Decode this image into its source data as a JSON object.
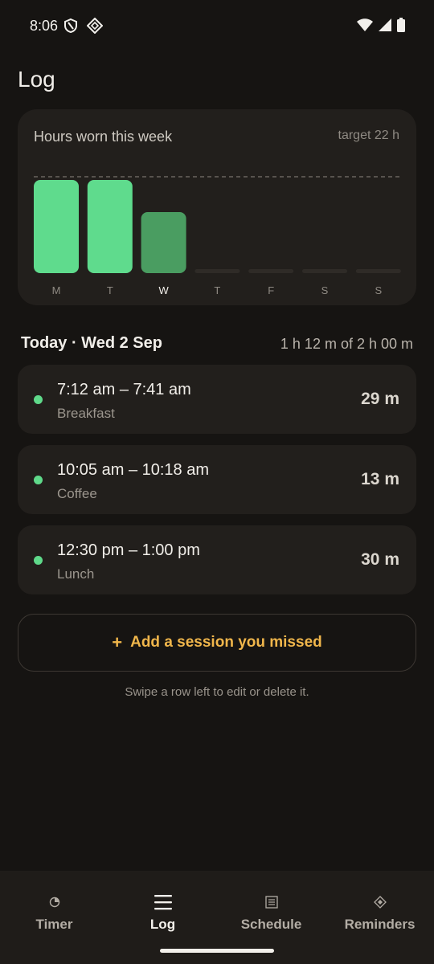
{
  "status_bar": {
    "time": "8:06"
  },
  "page": {
    "title": "Log"
  },
  "chart": {
    "title": "Hours worn this week",
    "target_label": "target 22 h"
  },
  "chart_data": {
    "type": "bar",
    "title": "Hours worn this week",
    "categories": [
      "M",
      "T",
      "W",
      "T",
      "F",
      "S",
      "S"
    ],
    "values": [
      5.8,
      5.8,
      3.8,
      0,
      0,
      0,
      0
    ],
    "target": 6,
    "ylim": [
      0,
      6.7
    ],
    "highlight_index": 2,
    "colors": {
      "bar": "#5fdb8d",
      "current": "#4a9d61",
      "empty": "#2f2b27",
      "target_line": "#6a655e"
    }
  },
  "today": {
    "header": "Today · Wed 2 Sep",
    "summary": "1 h 12 m of 2 h 00 m"
  },
  "sessions": [
    {
      "range": "7:12 am – 7:41 am",
      "label": "Breakfast",
      "duration": "29 m"
    },
    {
      "range": "10:05 am – 10:18 am",
      "label": "Coffee",
      "duration": "13 m"
    },
    {
      "range": "12:30 pm – 1:00 pm",
      "label": "Lunch",
      "duration": "30 m"
    }
  ],
  "add_button": {
    "plus": "+",
    "label": "Add a session you missed"
  },
  "hint": "Swipe a row left to edit or delete it.",
  "nav": {
    "active": "Log",
    "items": [
      {
        "label": "Timer",
        "icon": "timer-icon"
      },
      {
        "label": "Log",
        "icon": "menu-icon"
      },
      {
        "label": "Schedule",
        "icon": "schedule-icon"
      },
      {
        "label": "Reminders",
        "icon": "reminders-icon"
      }
    ]
  },
  "colors": {
    "accent": "#f0b64b",
    "green": "#5fd98a",
    "background": "#161412",
    "card": "#221f1c"
  }
}
